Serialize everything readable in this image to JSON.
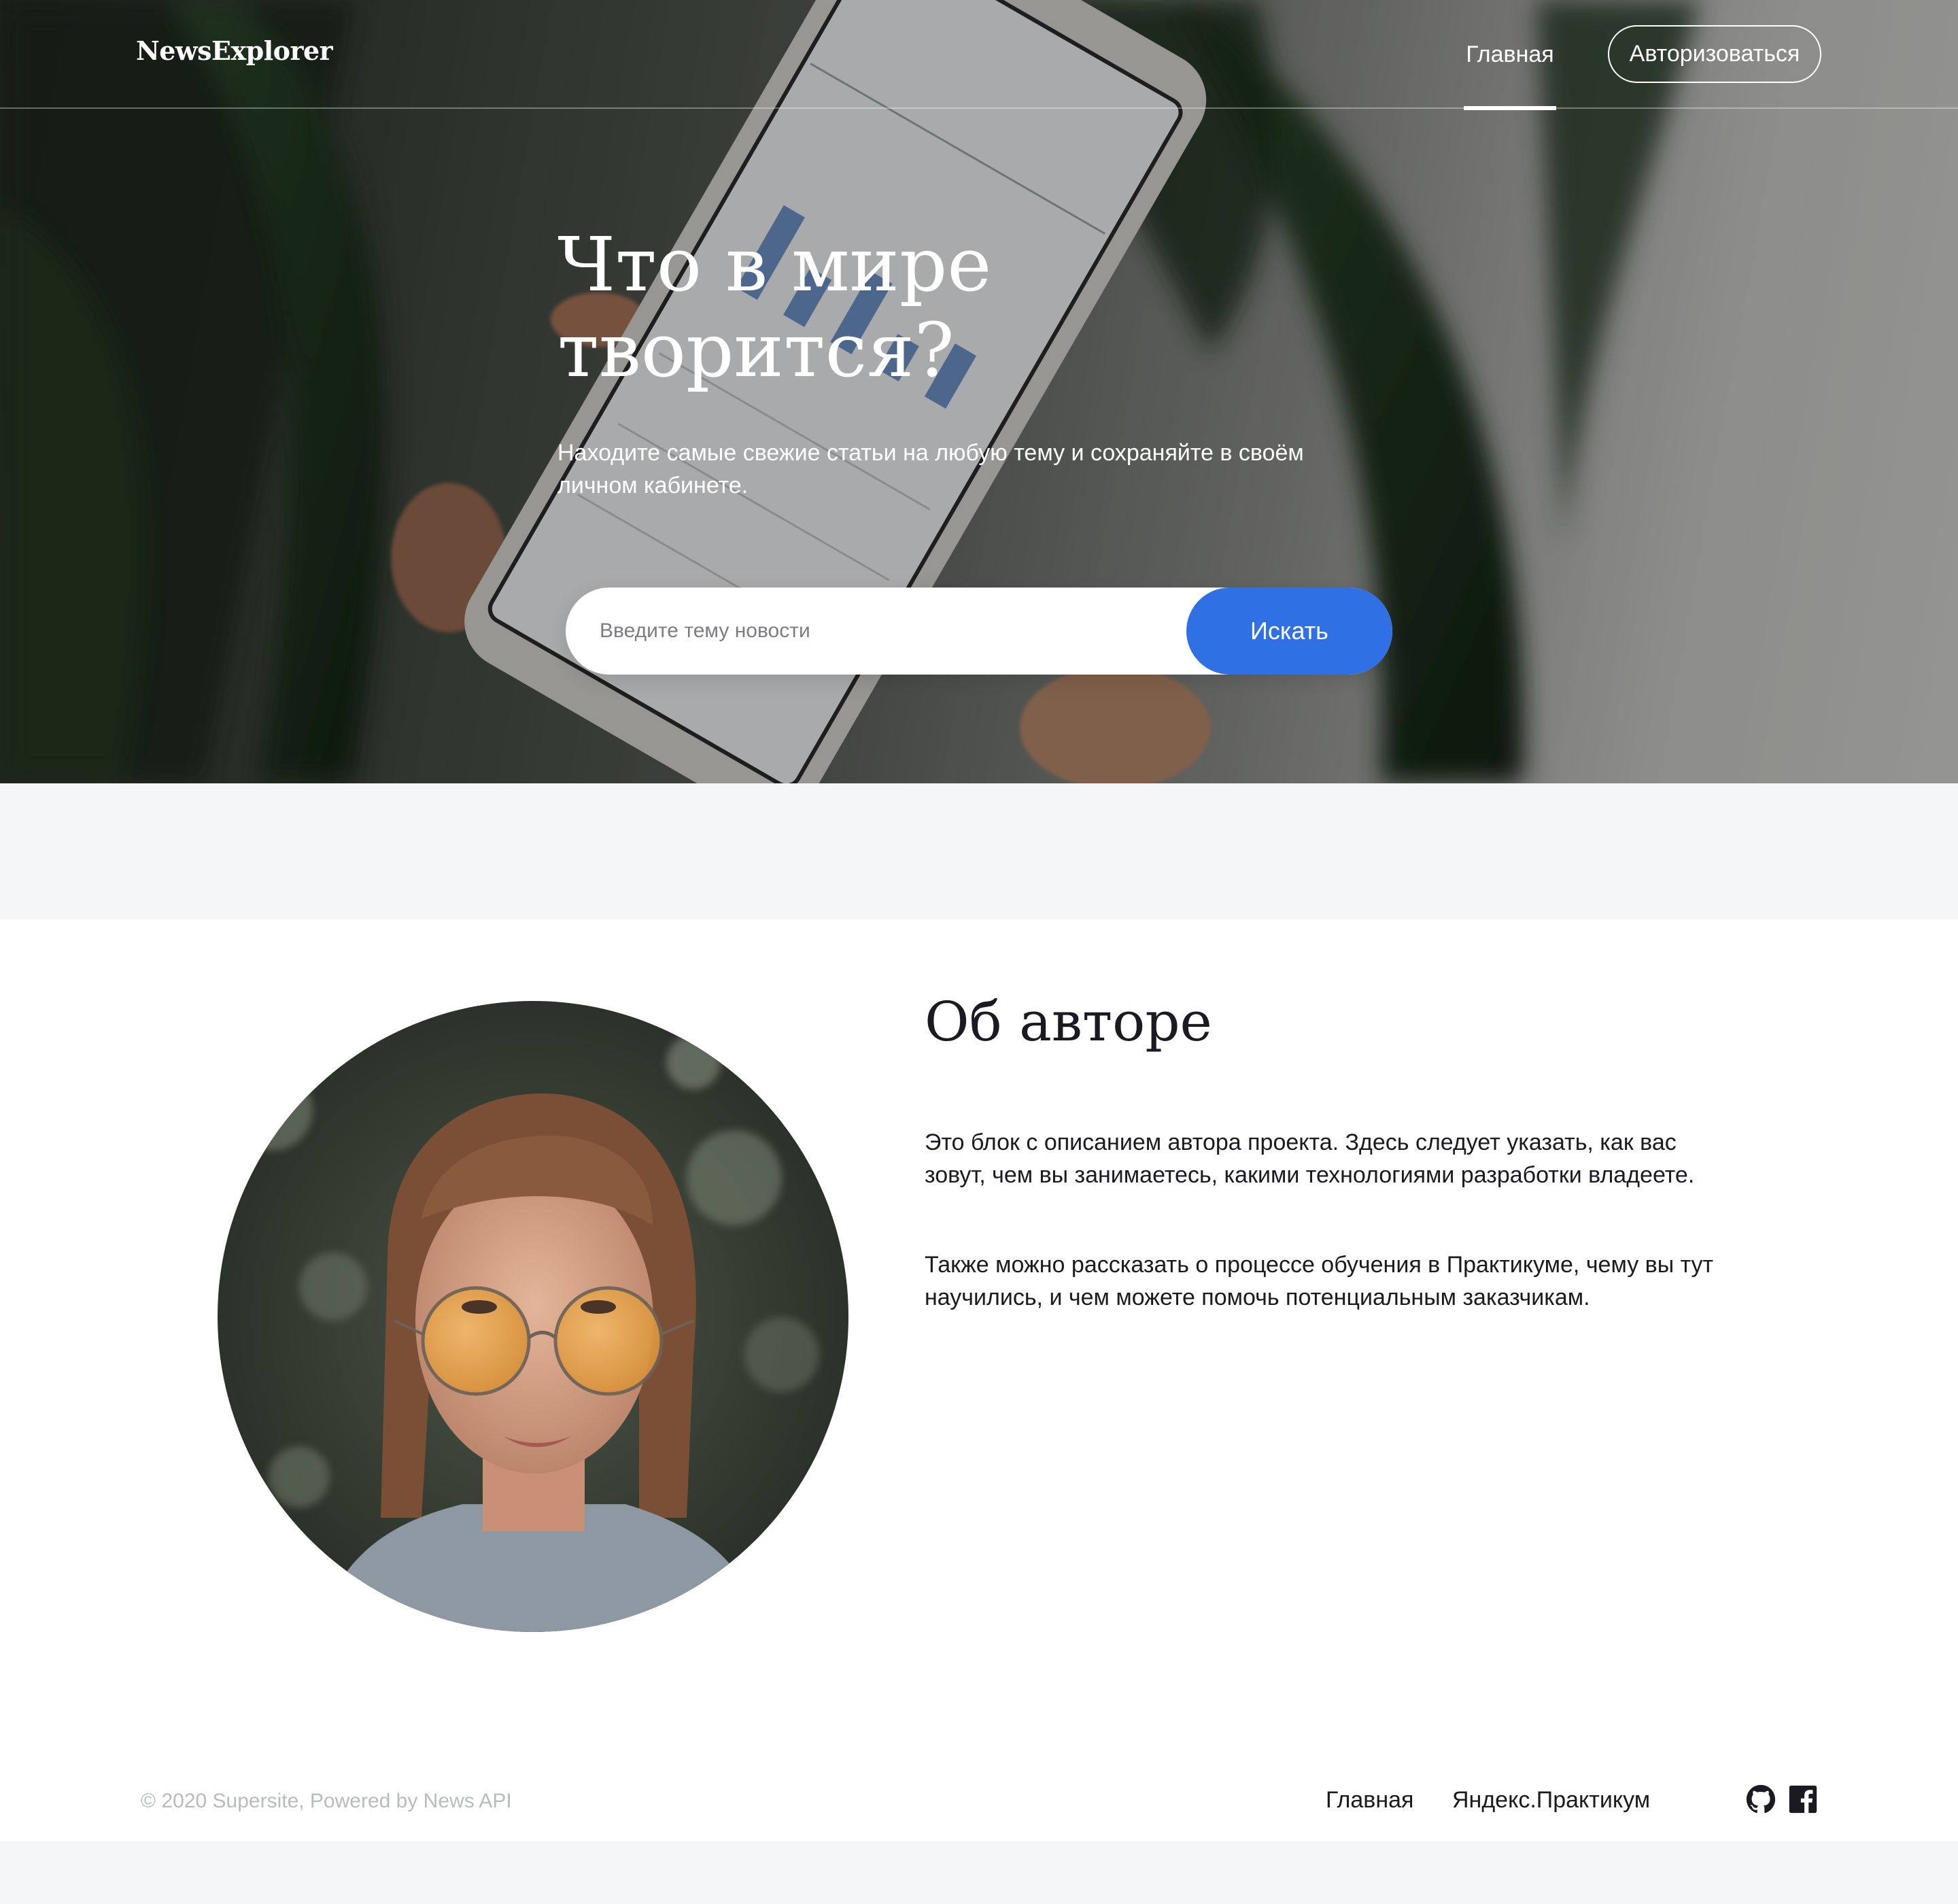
{
  "header": {
    "logo": "NewsExplorer",
    "nav_home": "Главная",
    "nav_auth": "Авторизоваться"
  },
  "hero": {
    "title_line1": "Что в мире",
    "title_line2": "творится?",
    "subtitle": "Находите самые свежие статьи на любую тему и сохраняйте в своём личном кабинете.",
    "search_placeholder": "Введите тему новости",
    "search_button": "Искать"
  },
  "about": {
    "title": "Об авторе",
    "paragraph1": "Это блок с описанием автора проекта. Здесь следует указать, как вас зовут, чем вы занимаетесь, какими технологиями разработки владеете.",
    "paragraph2": "Также можно рассказать о процессе обучения в Практикуме, чему вы тут научились, и чем можете помочь потенциальным заказчикам."
  },
  "footer": {
    "copyright": "© 2020 Supersite, Powered by News API",
    "link_home": "Главная",
    "link_practicum": "Яндекс.Практикум",
    "icons": [
      "github-icon",
      "facebook-icon"
    ]
  },
  "colors": {
    "accent": "#2f71e5",
    "text": "#1a1b22",
    "muted": "#b6bcbf",
    "page_bg": "#f5f6f7"
  }
}
